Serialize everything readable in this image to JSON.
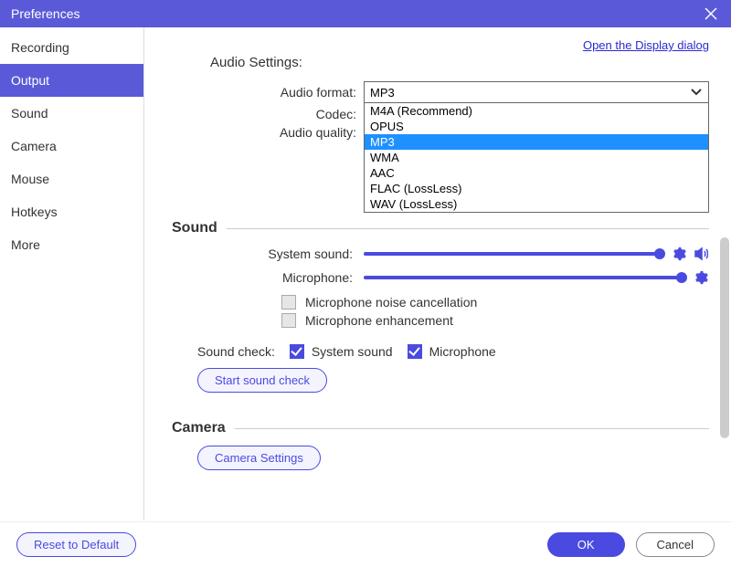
{
  "title": "Preferences",
  "display_link": "Open the Display dialog",
  "sidebar": {
    "items": [
      {
        "label": "Recording"
      },
      {
        "label": "Output"
      },
      {
        "label": "Sound"
      },
      {
        "label": "Camera"
      },
      {
        "label": "Mouse"
      },
      {
        "label": "Hotkeys"
      },
      {
        "label": "More"
      }
    ],
    "active_index": 1
  },
  "audio_settings": {
    "title": "Audio Settings:",
    "format_label": "Audio format:",
    "format_value": "MP3",
    "format_options": [
      "M4A (Recommend)",
      "OPUS",
      "MP3",
      "WMA",
      "AAC",
      "FLAC (LossLess)",
      "WAV (LossLess)"
    ],
    "codec_label": "Codec:",
    "quality_label": "Audio quality:"
  },
  "sound": {
    "title": "Sound",
    "system_label": "System sound:",
    "mic_label": "Microphone:",
    "noise_label": "Microphone noise cancellation",
    "enhance_label": "Microphone enhancement",
    "soundcheck_label": "Sound check:",
    "sc_system": "System sound",
    "sc_mic": "Microphone",
    "start_btn": "Start sound check"
  },
  "camera": {
    "title": "Camera",
    "settings_btn": "Camera Settings"
  },
  "footer": {
    "reset": "Reset to Default",
    "ok": "OK",
    "cancel": "Cancel"
  }
}
